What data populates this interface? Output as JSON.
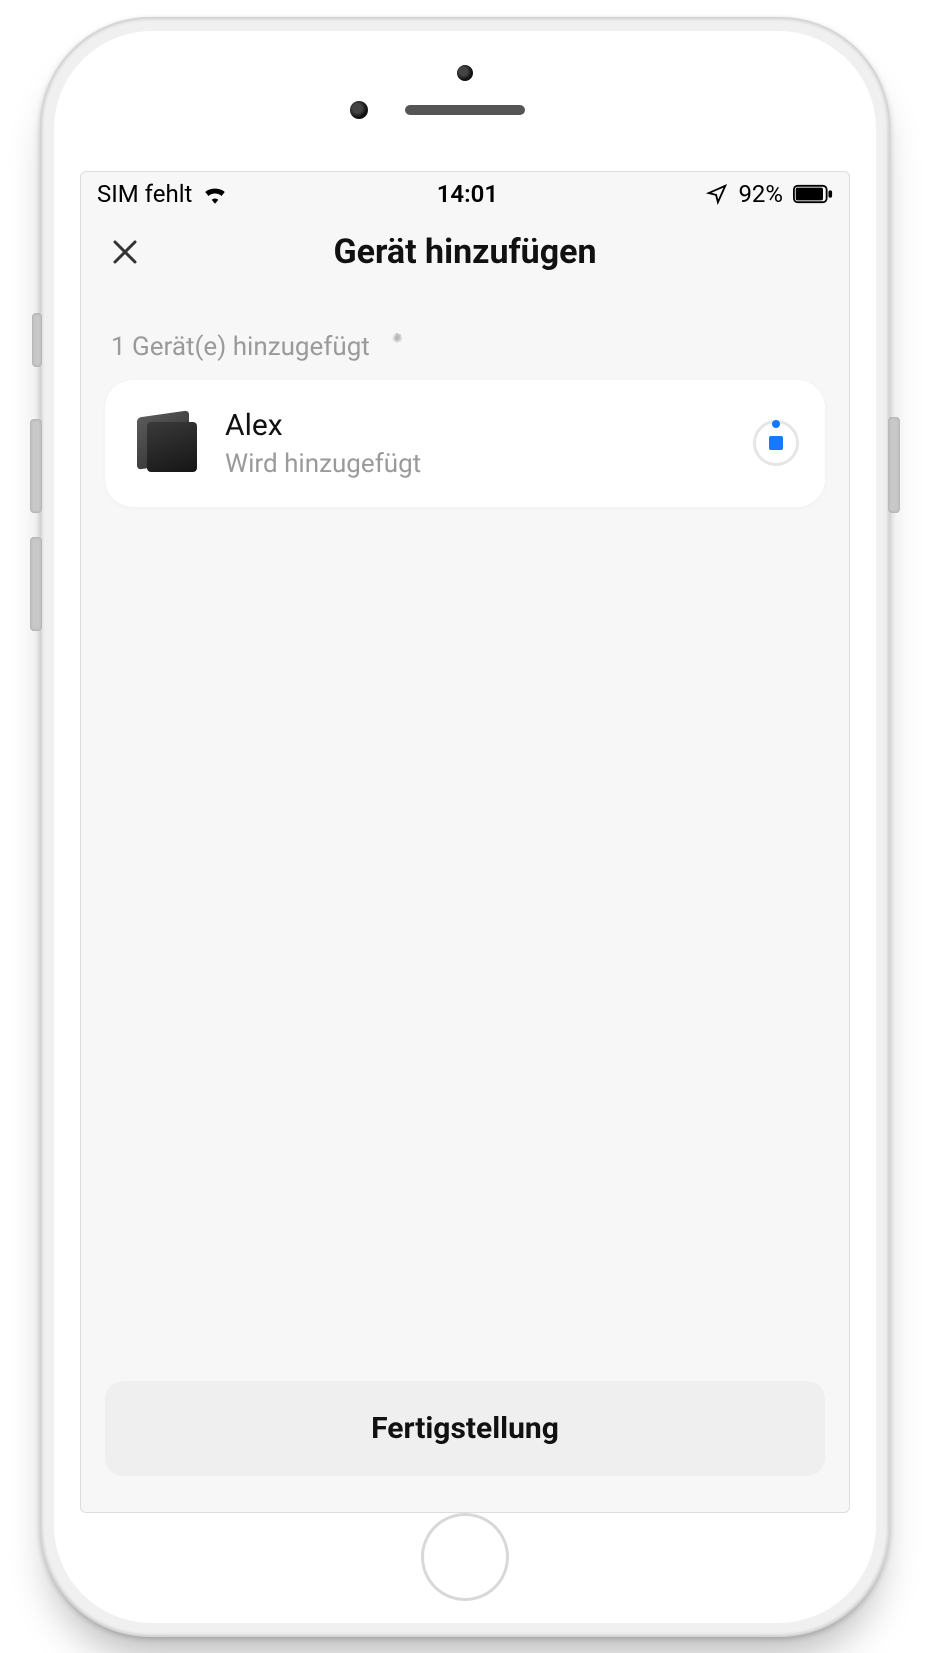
{
  "statusbar": {
    "carrier": "SIM fehlt",
    "time": "14:01",
    "battery": "92%"
  },
  "nav": {
    "title": "Gerät hinzufügen"
  },
  "list": {
    "count_label": "1 Gerät(e) hinzugefügt"
  },
  "device": {
    "name": "Alex",
    "status": "Wird hinzugefügt"
  },
  "footer": {
    "finish_label": "Fertigstellung"
  }
}
